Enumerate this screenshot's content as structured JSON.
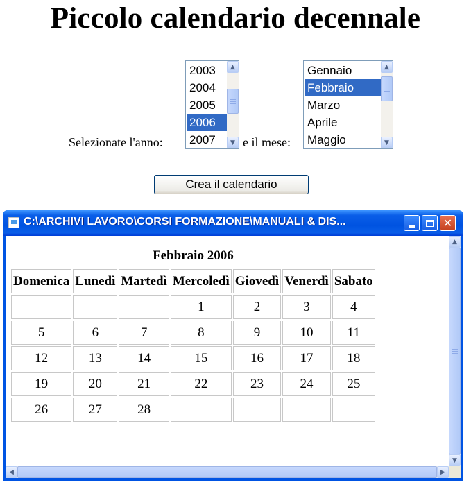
{
  "heading": "Piccolo calendario decennale",
  "form": {
    "year_label": "Selezionate l'anno:",
    "month_label": "e il mese:",
    "years": [
      "2003",
      "2004",
      "2005",
      "2006",
      "2007"
    ],
    "selected_year": "2006",
    "months": [
      "Gennaio",
      "Febbraio",
      "Marzo",
      "Aprile",
      "Maggio"
    ],
    "selected_month": "Febbraio",
    "submit_label": "Crea il calendario"
  },
  "popup": {
    "title": "C:\\ARCHIVI LAVORO\\CORSI FORMAZIONE\\MANUALI & DIS...",
    "calendar": {
      "caption": "Febbraio 2006",
      "weekdays": [
        "Domenica",
        "Lunedì",
        "Martedì",
        "Mercoledì",
        "Giovedì",
        "Venerdì",
        "Sabato"
      ],
      "weeks": [
        [
          "",
          "",
          "",
          "1",
          "2",
          "3",
          "4"
        ],
        [
          "5",
          "6",
          "7",
          "8",
          "9",
          "10",
          "11"
        ],
        [
          "12",
          "13",
          "14",
          "15",
          "16",
          "17",
          "18"
        ],
        [
          "19",
          "20",
          "21",
          "22",
          "23",
          "24",
          "25"
        ],
        [
          "26",
          "27",
          "28",
          "",
          "",
          "",
          ""
        ]
      ]
    }
  },
  "colors": {
    "selection": "#316ac5",
    "titlebar": "#0054e3",
    "close_button": "#d9552e"
  },
  "icons": [
    "scroll-up-arrow-icon",
    "scroll-down-arrow-icon",
    "scroll-left-arrow-icon",
    "scroll-right-arrow-icon",
    "ie-window-icon",
    "minimize-icon",
    "maximize-icon",
    "close-icon"
  ]
}
